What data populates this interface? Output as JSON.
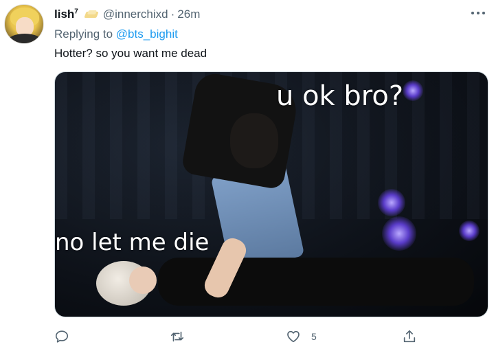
{
  "tweet": {
    "display_name": "lish",
    "display_name_sup": "7",
    "badge_icon": "butter-emoji",
    "handle": "@innerchixd",
    "separator": "·",
    "time": "26m",
    "reply_prefix": "Replying to",
    "reply_mention": "@bts_bighit",
    "text": "Hotter? so you want me dead",
    "media": {
      "caption_top": "u ok bro?",
      "caption_bottom": "no let me die"
    },
    "actions": {
      "reply_icon": "reply-icon",
      "retweet_icon": "retweet-icon",
      "like_icon": "heart-icon",
      "like_count": "5",
      "share_icon": "share-icon"
    }
  },
  "colors": {
    "text_primary": "#0f1419",
    "text_secondary": "#536471",
    "link": "#1d9bf0",
    "border": "#cfd9de"
  }
}
